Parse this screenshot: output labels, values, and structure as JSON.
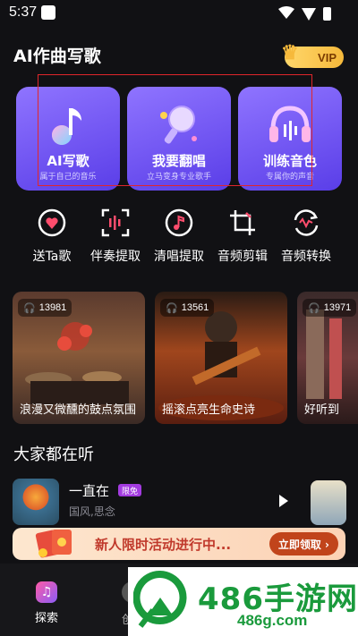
{
  "status_bar": {
    "time": "5:37"
  },
  "header": {
    "title": "AI作曲写歌",
    "vip_label": "VIP"
  },
  "features": [
    {
      "title": "AI写歌",
      "subtitle": "属于自己的音乐",
      "icon": "music-note-icon"
    },
    {
      "title": "我要翻唱",
      "subtitle": "立马变身专业歌手",
      "icon": "microphone-icon"
    },
    {
      "title": "训练音色",
      "subtitle": "专属你的声音",
      "icon": "headphones-icon"
    }
  ],
  "tools": [
    {
      "label": "送Ta歌",
      "icon": "heart-pin-icon"
    },
    {
      "label": "伴奏提取",
      "icon": "waveform-scan-icon"
    },
    {
      "label": "清唱提取",
      "icon": "music-disc-icon"
    },
    {
      "label": "音频剪辑",
      "icon": "crop-icon"
    },
    {
      "label": "音频转换",
      "icon": "convert-icon"
    }
  ],
  "playlists": [
    {
      "count": "13981",
      "caption": "浪漫又微醺的鼓点氛围"
    },
    {
      "count": "13561",
      "caption": "摇滚点亮生命史诗"
    },
    {
      "count": "13971",
      "caption": "好听到"
    }
  ],
  "section": {
    "title": "大家都在听"
  },
  "song": {
    "name": "一直在",
    "tag": "限免",
    "subtitle": "国风,思念"
  },
  "promo": {
    "text": "新人限时活动进行中...",
    "button": "立即领取 ›"
  },
  "tabbar": {
    "explore_label": "探索",
    "create_label": "创"
  },
  "watermark": {
    "main": "486手游网",
    "url": "486g.com"
  },
  "colors": {
    "accent": "#7b5cff",
    "vip": "#f6b93b",
    "promo_btn": "#c1441b"
  }
}
